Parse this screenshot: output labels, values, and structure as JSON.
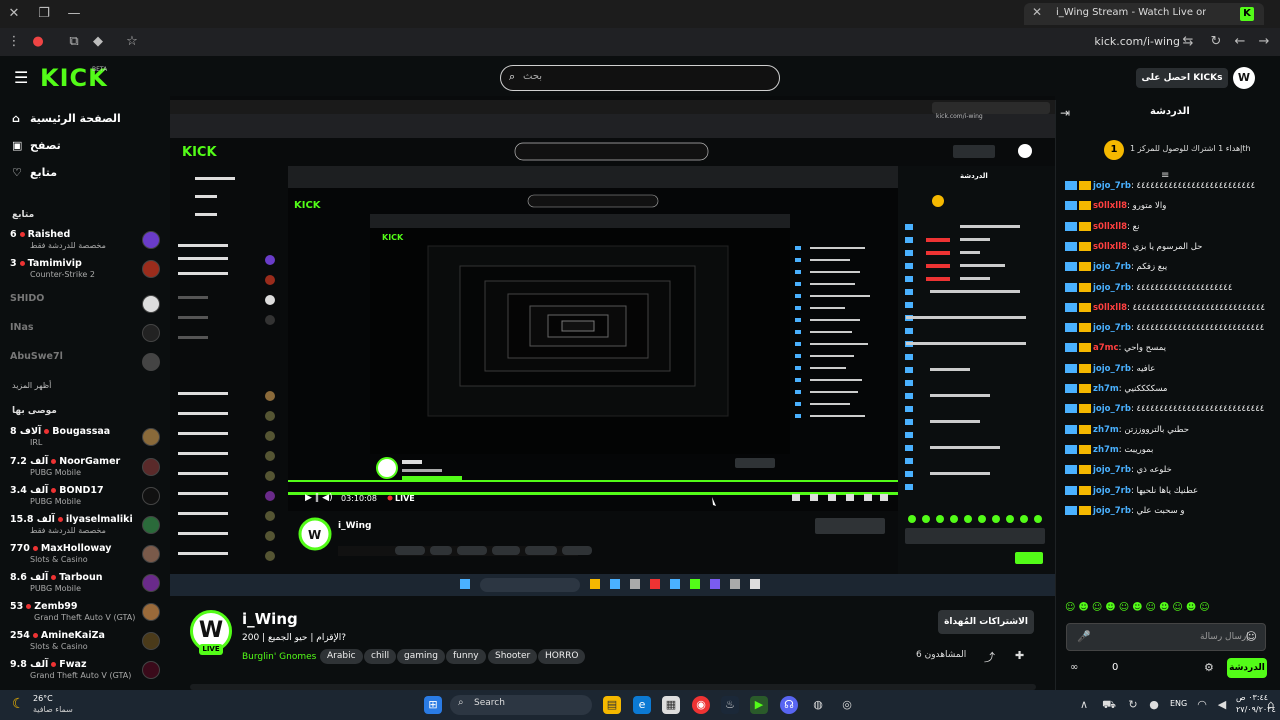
{
  "browser": {
    "tab_title": "i_Wing Stream - Watch Live on",
    "tab_favicon": "K",
    "url": "kick.com/i-wing"
  },
  "header": {
    "logo": "KICK",
    "logo_badge": "BETA",
    "search_placeholder": "بحث",
    "kicks_button": "احصل على KICKs",
    "avatar_initial": "W"
  },
  "sidebar": {
    "nav": [
      {
        "label": "الصفحة الرئيسية",
        "icon": "home-icon"
      },
      {
        "label": "تصفح",
        "icon": "browse-icon"
      },
      {
        "label": "متابع",
        "icon": "heart-icon"
      }
    ],
    "following_heading": "متابع",
    "following": [
      {
        "name": "Raished",
        "viewers": "6",
        "sub": "مخصصة للدردشة فقط",
        "live": true
      },
      {
        "name": "Tamimivip",
        "viewers": "3",
        "sub": "Counter-Strike 2",
        "live": true
      },
      {
        "name": "SHIDO",
        "viewers": "",
        "sub": "",
        "live": false
      },
      {
        "name": "INas",
        "viewers": "",
        "sub": "",
        "live": false
      },
      {
        "name": "AbuSwe7l",
        "viewers": "",
        "sub": "",
        "live": false
      }
    ],
    "show_more": "أظهر المزيد",
    "recommended_heading": "موصى بها",
    "recommended": [
      {
        "name": "Bougassaa",
        "viewers": "8 آلاف",
        "sub": "IRL"
      },
      {
        "name": "NoorGamer",
        "viewers": "7.2 آلف",
        "sub": "PUBG Mobile"
      },
      {
        "name": "BOND17",
        "viewers": "3.4 آلف",
        "sub": "PUBG Mobile"
      },
      {
        "name": "ilyaselmaliki",
        "viewers": "15.8 آلف",
        "sub": "مخصصة للدردشة فقط"
      },
      {
        "name": "MaxHolloway",
        "viewers": "770",
        "sub": "Slots & Casino"
      },
      {
        "name": "Tarboun",
        "viewers": "8.6 آلف",
        "sub": "PUBG Mobile"
      },
      {
        "name": "Zemb99",
        "viewers": "53",
        "sub": "Grand Theft Auto V (GTA)"
      },
      {
        "name": "AmineKaiZa",
        "viewers": "254",
        "sub": "Slots & Casino"
      },
      {
        "name": "Fwaz",
        "viewers": "9.8 آلف",
        "sub": "Grand Theft Auto V (GTA)"
      }
    ]
  },
  "channel": {
    "avatar_initial": "W",
    "live_badge": "LIVE",
    "name": "i_Wing",
    "title": "الإقزام | حيو الجميع | 200?",
    "category": "Burglin' Gnomes",
    "tags": [
      "Arabic",
      "chill",
      "gaming",
      "funny",
      "Shooter",
      "HORRO"
    ],
    "subs_button": "الاشتراكات المُهداة",
    "viewers": "6 المشاهدون"
  },
  "video": {
    "time": "03:10:08",
    "live_label": "LIVE"
  },
  "chat": {
    "title": "الدردشة",
    "pinned_badge": "1",
    "pinned_text": "إهداء 1 اشتراك للوصول للمركز 1th",
    "messages": [
      {
        "user": "jojo_7rb",
        "color": "#4ab1ff",
        "text": "٤٤٤٤٤٤٤٤٤٤٤٤٤٤٤٤٤٤٤٤٤٤٤٤٤٤"
      },
      {
        "user": "s0llxll8",
        "color": "#ff4040",
        "text": "والا متورو"
      },
      {
        "user": "s0llxll8",
        "color": "#ff4040",
        "text": "نع"
      },
      {
        "user": "s0llxll8",
        "color": "#ff4040",
        "text": "حل المرسوم يا بزي"
      },
      {
        "user": "jojo_7rb",
        "color": "#4ab1ff",
        "text": "يبع زفكم"
      },
      {
        "user": "jojo_7rb",
        "color": "#4ab1ff",
        "text": "٤٤٤٤٤٤٤٤٤٤٤٤٤٤٤٤٤٤٤٤٤"
      },
      {
        "user": "s0llxll8",
        "color": "#ff4040",
        "text": "٤٤٤٤٤٤٤٤٤٤٤٤٤٤٤٤٤٤٤٤٤٤٤٤٤٤٤٤٤٤٤٤٤٤٤٤٤٤٤٤٤٤"
      },
      {
        "user": "jojo_7rb",
        "color": "#4ab1ff",
        "text": "٤٤٤٤٤٤٤٤٤٤٤٤٤٤٤٤٤٤٤٤٤٤٤٤٤٤٤٤٤٤٤٤٤٤٤٤٤٤٤٤"
      },
      {
        "user": "a7mc",
        "color": "#ff4040",
        "text": "يمسح واحي"
      },
      {
        "user": "jojo_7rb",
        "color": "#4ab1ff",
        "text": "عافيه"
      },
      {
        "user": "zh7m",
        "color": "#4ab1ff",
        "text": "مسككككنيي"
      },
      {
        "user": "jojo_7rb",
        "color": "#4ab1ff",
        "text": "٤٤٤٤٤٤٤٤٤٤٤٤٤٤٤٤٤٤٤٤٤٤٤٤٤٤٤٤٤٤٤٤٤"
      },
      {
        "user": "zh7m",
        "color": "#4ab1ff",
        "text": "حطني بالترووززتن"
      },
      {
        "user": "zh7m",
        "color": "#4ab1ff",
        "text": "بموريبت"
      },
      {
        "user": "jojo_7rb",
        "color": "#4ab1ff",
        "text": "خلوعه ذي"
      },
      {
        "user": "jojo_7rb",
        "color": "#4ab1ff",
        "text": "عطنيك ياها نلحيها"
      },
      {
        "user": "jojo_7rb",
        "color": "#4ab1ff",
        "text": "و سحبت علي"
      }
    ],
    "emotes": "☺☻☺☻☺☻☺☻☺☻☺",
    "input_placeholder": "إرسال رسالة",
    "send_button": "الدردشة",
    "kicks_count": "0"
  },
  "taskbar": {
    "temp": "26°C",
    "weather": "سماء صافية",
    "search": "Search",
    "lang": "ENG",
    "time": "٠٣:٤٤ ص",
    "date": "٢٧/٠٩/٢٠٢٤"
  },
  "colors": {
    "brand": "#53fc18",
    "background": "#0b0e0f",
    "panel": "#2f3336"
  }
}
